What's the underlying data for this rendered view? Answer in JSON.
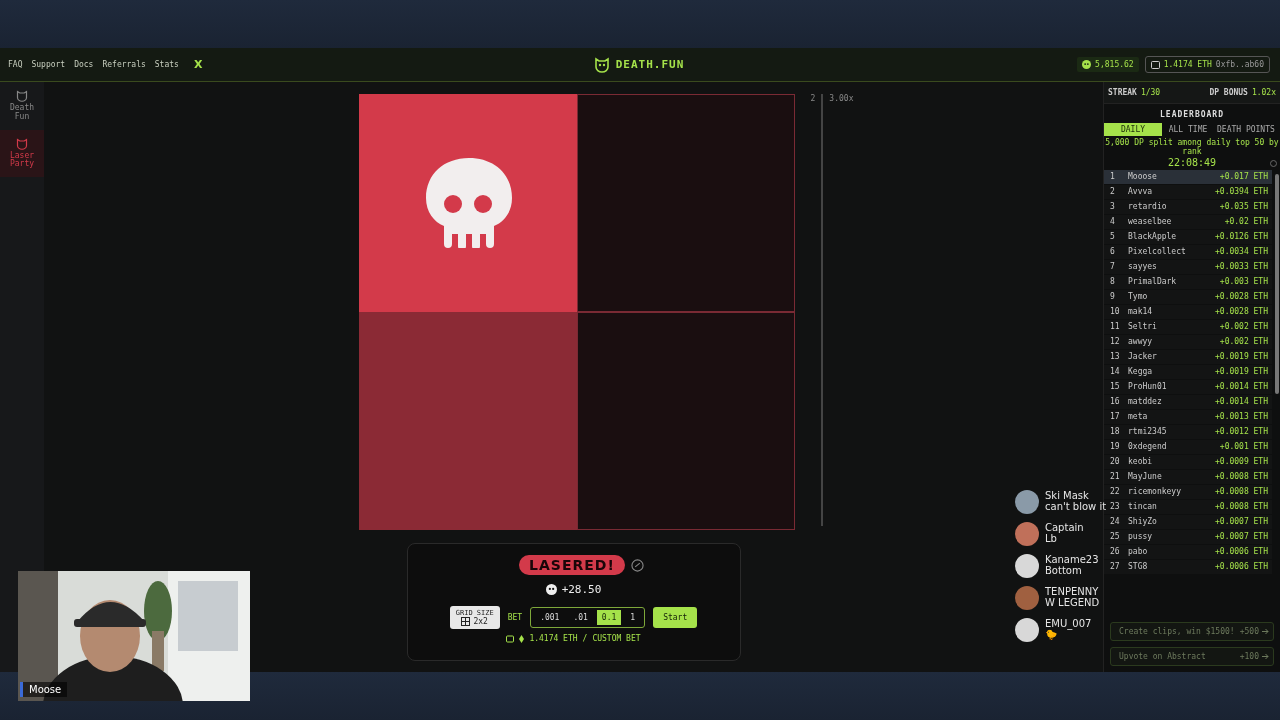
{
  "nav": {
    "links": [
      "FAQ",
      "Support",
      "Docs",
      "Referrals",
      "Stats"
    ],
    "x_label": "X"
  },
  "logo": "DEATH.FUN",
  "balance": "5,815.62",
  "wallet": {
    "eth": "1.4174 ETH",
    "address": "0xfb..ab60"
  },
  "sidebar": [
    {
      "label": "Death Fun",
      "selected": false
    },
    {
      "label": "Laser Party",
      "selected": true
    }
  ],
  "grid": {
    "cells": [
      {
        "kind": "skull"
      },
      {
        "kind": "hidden"
      },
      {
        "kind": "revealed"
      },
      {
        "kind": "hidden"
      }
    ],
    "axis": {
      "row": "2",
      "multiplier": "3.00x"
    }
  },
  "result": {
    "badge": "LASERED!",
    "amount": "+28.50"
  },
  "controls": {
    "grid_size_label": "GRID SIZE",
    "grid_size": "2x2",
    "bet_label": "BET",
    "bets": [
      {
        "label": ".001",
        "selected": false
      },
      {
        "label": ".01",
        "selected": false
      },
      {
        "label": "0.1",
        "selected": true
      },
      {
        "label": "1",
        "selected": false
      }
    ],
    "start": "Start",
    "balance": "1.4174 ETH",
    "separator": "/",
    "custom": "CUSTOM BET"
  },
  "stats": {
    "streak_label": "STREAK",
    "streak": "1/30",
    "bonus_label": "DP BONUS",
    "bonus": "1.02x"
  },
  "leaderboard": {
    "title": "LEADERBOARD",
    "tabs": [
      {
        "label": "DAILY",
        "selected": true
      },
      {
        "label": "ALL TIME",
        "selected": false
      },
      {
        "label": "DEATH POINTS",
        "selected": false
      }
    ],
    "note": "5,000 DP split among daily top 50 by rank",
    "timer": "22:08:49",
    "rows": [
      {
        "rank": "1",
        "name": "Mooose",
        "amount": "+0.017 ETH",
        "selected": true
      },
      {
        "rank": "2",
        "name": "Avvva",
        "amount": "+0.0394 ETH",
        "selected": false
      },
      {
        "rank": "3",
        "name": "retardio",
        "amount": "+0.035 ETH",
        "selected": false
      },
      {
        "rank": "4",
        "name": "weaselbee",
        "amount": "+0.02 ETH",
        "selected": false
      },
      {
        "rank": "5",
        "name": "BlackApple",
        "amount": "+0.0126 ETH",
        "selected": false
      },
      {
        "rank": "6",
        "name": "Pixelcollect",
        "amount": "+0.0034 ETH",
        "selected": false
      },
      {
        "rank": "7",
        "name": "sayyes",
        "amount": "+0.0033 ETH",
        "selected": false
      },
      {
        "rank": "8",
        "name": "PrimalDark",
        "amount": "+0.003 ETH",
        "selected": false
      },
      {
        "rank": "9",
        "name": "Tymo",
        "amount": "+0.0028 ETH",
        "selected": false
      },
      {
        "rank": "10",
        "name": "mak14",
        "amount": "+0.0028 ETH",
        "selected": false
      },
      {
        "rank": "11",
        "name": "Seltri",
        "amount": "+0.002 ETH",
        "selected": false
      },
      {
        "rank": "12",
        "name": "awwyy",
        "amount": "+0.002 ETH",
        "selected": false
      },
      {
        "rank": "13",
        "name": "Jacker",
        "amount": "+0.0019 ETH",
        "selected": false
      },
      {
        "rank": "14",
        "name": "Kegga",
        "amount": "+0.0019 ETH",
        "selected": false
      },
      {
        "rank": "15",
        "name": "ProHun01",
        "amount": "+0.0014 ETH",
        "selected": false
      },
      {
        "rank": "16",
        "name": "matddez",
        "amount": "+0.0014 ETH",
        "selected": false
      },
      {
        "rank": "17",
        "name": "meta",
        "amount": "+0.0013 ETH",
        "selected": false
      },
      {
        "rank": "18",
        "name": "rtmi2345",
        "amount": "+0.0012 ETH",
        "selected": false
      },
      {
        "rank": "19",
        "name": "0xdegend",
        "amount": "+0.001 ETH",
        "selected": false
      },
      {
        "rank": "20",
        "name": "keobi",
        "amount": "+0.0009 ETH",
        "selected": false
      },
      {
        "rank": "21",
        "name": "MayJune",
        "amount": "+0.0008 ETH",
        "selected": false
      },
      {
        "rank": "22",
        "name": "ricemonkeyy",
        "amount": "+0.0008 ETH",
        "selected": false
      },
      {
        "rank": "23",
        "name": "tincan",
        "amount": "+0.0008 ETH",
        "selected": false
      },
      {
        "rank": "24",
        "name": "ShiyZo",
        "amount": "+0.0007 ETH",
        "selected": false
      },
      {
        "rank": "25",
        "name": "pussy",
        "amount": "+0.0007 ETH",
        "selected": false
      },
      {
        "rank": "26",
        "name": "pabo",
        "amount": "+0.0006 ETH",
        "selected": false
      },
      {
        "rank": "27",
        "name": "STG8",
        "amount": "+0.0006 ETH",
        "selected": false
      }
    ]
  },
  "quests": [
    {
      "label": "Create clips, win $1500!",
      "reward": "+500"
    },
    {
      "label": "Upvote on Abstract",
      "reward": "+100"
    }
  ],
  "chat": [
    {
      "user": "Ski Mask",
      "text": "can't blow it",
      "color": "#8a9aa8"
    },
    {
      "user": "Captain",
      "text": "Lb",
      "color": "#c0705a"
    },
    {
      "user": "Kaname23",
      "text": "Bottom",
      "color": "#d8d8d8"
    },
    {
      "user": "TENPENNY",
      "text": "W LEGEND",
      "color": "#a06040"
    },
    {
      "user": "EMU_007",
      "text": "🐤",
      "color": "#d8d8d8"
    }
  ],
  "webcam": {
    "name": "Moose"
  }
}
